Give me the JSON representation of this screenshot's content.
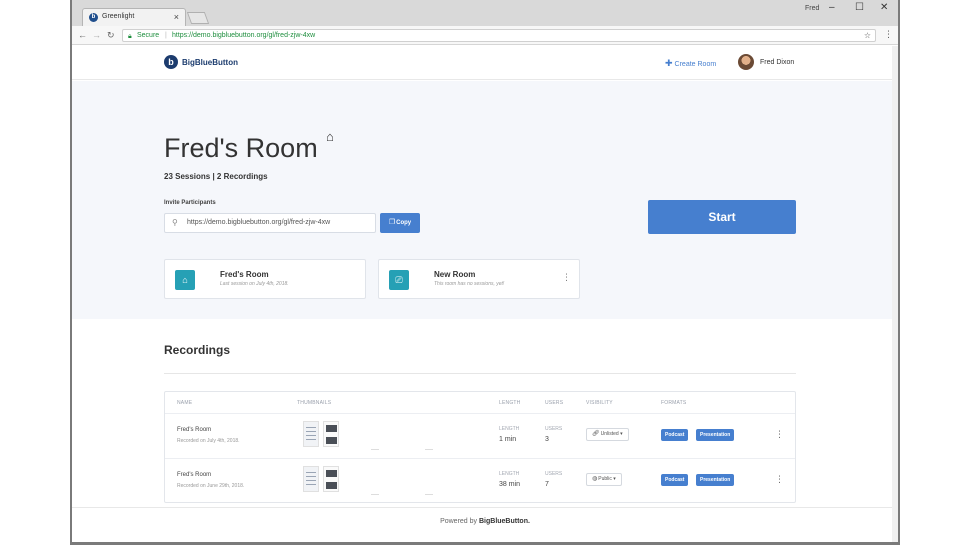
{
  "browser": {
    "tab_title": "Greenlight",
    "window_user": "Fred",
    "secure_label": "Secure",
    "url": "https://demo.bigbluebutton.org/gl/fred-zjw-4xw"
  },
  "header": {
    "logo_letter": "b",
    "logo_text": "BigBlueButton",
    "create_room_label": "Create Room",
    "user_name": "Fred Dixon"
  },
  "room": {
    "title": "Fred's Room",
    "stats": "23 Sessions | 2 Recordings",
    "invite_label": "Invite Participants",
    "invite_url": "https://demo.bigbluebutton.org/gl/fred-zjw-4xw",
    "copy_label": "Copy",
    "start_label": "Start"
  },
  "room_cards": [
    {
      "name": "Fred's Room",
      "subtitle": "Last session on July 4th, 2018."
    },
    {
      "name": "New Room",
      "subtitle": "This room has no sessions, yet!"
    }
  ],
  "recordings": {
    "title": "Recordings",
    "columns": {
      "name": "NAME",
      "thumbnails": "THUMBNAILS",
      "length": "LENGTH",
      "users": "USERS",
      "visibility": "VISIBILITY",
      "formats": "FORMATS"
    },
    "rows": [
      {
        "name": "Fred's Room",
        "date": "Recorded on July 4th, 2018.",
        "length_label": "LENGTH",
        "length": "1 min",
        "users_label": "USERS",
        "users": "3",
        "visibility": "Unlisted ▾",
        "formats": [
          "Podcast",
          "Presentation"
        ]
      },
      {
        "name": "Fred's Room",
        "date": "Recorded on June 29th, 2018.",
        "length_label": "LENGTH",
        "length": "38 min",
        "users_label": "USERS",
        "users": "7",
        "visibility": "Public ▾",
        "formats": [
          "Podcast",
          "Presentation"
        ]
      }
    ]
  },
  "footer": {
    "prefix": "Powered by",
    "brand": "BigBlueButton."
  },
  "colors": {
    "accent": "#467fcf",
    "hero_bg": "#f5f7fb",
    "card_icon": "#26a0b5"
  }
}
